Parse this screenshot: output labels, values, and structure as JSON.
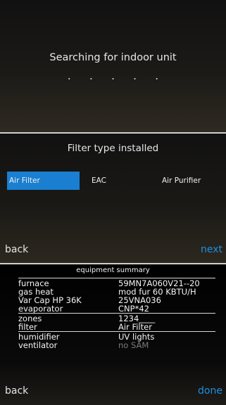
{
  "search_panel": {
    "message": "Searching for indoor unit",
    "dots": "....."
  },
  "filter_panel": {
    "title": "Filter type installed",
    "options": [
      {
        "label": "Air Filter",
        "selected": true
      },
      {
        "label": "EAC",
        "selected": false
      },
      {
        "label": "Air Purifier",
        "selected": false
      }
    ],
    "back_label": "back",
    "next_label": "next"
  },
  "summary_panel": {
    "title": "equipment summary",
    "groups": [
      [
        {
          "label": "furnace",
          "value": "59MN7A060V21--20"
        },
        {
          "label": "gas heat",
          "value": "mod fur 60 KBTU/H"
        },
        {
          "label": "Var Cap HP 36K",
          "value": "25VNA036"
        },
        {
          "label": "evaporator",
          "value": "CNP*42"
        }
      ],
      [
        {
          "label": "zones",
          "value": "1234____"
        },
        {
          "label": "filter",
          "value": "Air Filter"
        }
      ],
      [
        {
          "label": "humidifier",
          "value": "UV lights"
        },
        {
          "label": "ventilator",
          "value": "no SAM",
          "muted": true
        }
      ]
    ],
    "back_label": "back",
    "done_label": "done"
  },
  "colors": {
    "accent": "#1a7fd0",
    "nav_forward": "#1e90e0",
    "divider": "#cfcfcf",
    "muted_text": "#7a7a7a"
  }
}
